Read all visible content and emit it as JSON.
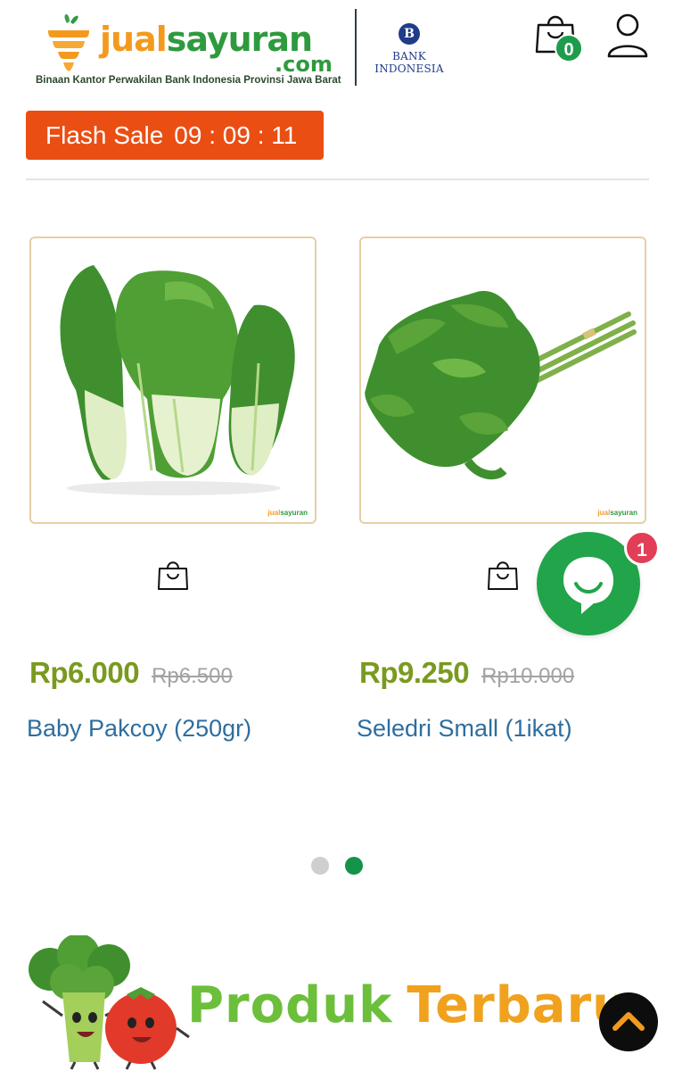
{
  "brand": {
    "word_1": "jual",
    "word_2": "sayuran",
    "domain": ".com",
    "tagline": "Binaan Kantor Perwakilan Bank Indonesia Provinsi Jawa Barat",
    "partner_emblem": "B",
    "partner_name": "BANK INDONESIA",
    "colors": {
      "orange": "#f39a1e",
      "green": "#2e9a3e",
      "partner_blue": "#1f3c88"
    }
  },
  "header": {
    "cart_icon": "shopping-bag-icon",
    "cart_count": "0",
    "user_icon": "user-icon"
  },
  "flash_sale": {
    "label": "Flash Sale",
    "timer": "09 : 09 : 11",
    "color": "#ea4e13"
  },
  "products": [
    {
      "image": "bok-choy-photo",
      "price": "Rp6.000",
      "old_price": "Rp6.500",
      "name": "Baby Pakcoy (250gr)",
      "action_icon": "shopping-bag-icon",
      "watermark_1": "jual",
      "watermark_2": "sayuran"
    },
    {
      "image": "celery-photo",
      "price": "Rp9.250",
      "old_price": "Rp10.000",
      "name": "Seledri Small (1ikat)",
      "action_icon": "shopping-bag-icon",
      "watermark_1": "jual",
      "watermark_2": "sayuran"
    }
  ],
  "chat": {
    "icon": "chat-bubble-icon",
    "badge": "1",
    "color": "#22a44a"
  },
  "carousel": {
    "page_count": 2,
    "active_page": 2,
    "active_color": "#14934a",
    "inactive_color": "#cfcfcf"
  },
  "section_banner": {
    "word_1": "Produk",
    "word_2": "Terbaru",
    "mascot": "broccoli-tomato-mascot"
  },
  "scroll_top": {
    "icon": "chevron-up-icon",
    "arrow_color": "#f39a1e"
  }
}
